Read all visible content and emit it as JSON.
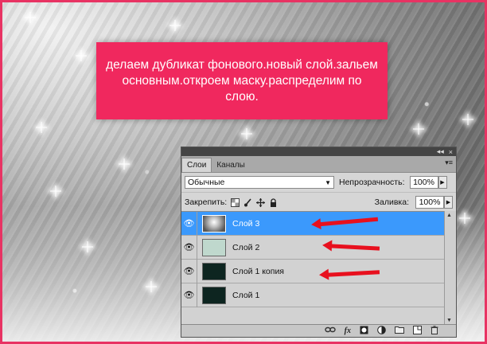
{
  "caption": {
    "line1": "делаем дубликат фонового.новый слой.зальем",
    "line2": "основным.откроем маску.распределим по",
    "line3": "слою."
  },
  "panel": {
    "collapse_label": "◂◂",
    "close_label": "×",
    "tabs": [
      {
        "label": "Слои"
      },
      {
        "label": "Каналы"
      }
    ],
    "menu_icon": "▾≡",
    "blend_mode": "Обычные",
    "opacity_label": "Непрозрачность:",
    "opacity_value": "100%",
    "lock_label": "Закрепить:",
    "fill_label": "Заливка:",
    "fill_value": "100%",
    "layers": [
      {
        "name": "Слой 3"
      },
      {
        "name": "Слой 2"
      },
      {
        "name": "Слой 1 копия"
      },
      {
        "name": "Слой 1"
      }
    ],
    "footer_icons": [
      "link-icon",
      "fx-icon",
      "mask-icon",
      "adjustment-icon",
      "group-folder-icon",
      "new-layer-icon",
      "trash-icon"
    ],
    "footer_fx": "fx"
  },
  "colors": {
    "caption_bg": "#f0285e",
    "frame_border": "#e83363",
    "selection": "#3b99fc",
    "arrow": "#e8101e"
  }
}
